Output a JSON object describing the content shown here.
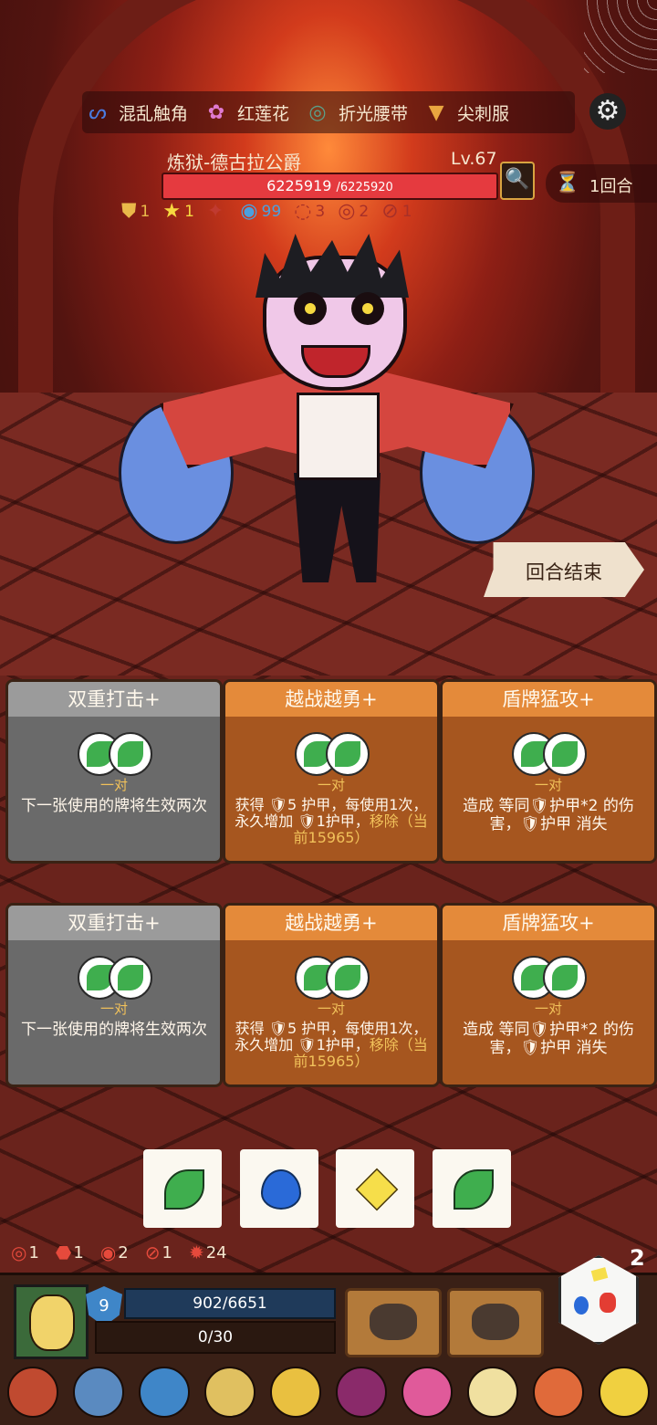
{
  "relics": [
    {
      "name": "混乱触角",
      "icon": "tentacle-icon",
      "color": "#4a7be0"
    },
    {
      "name": "红莲花",
      "icon": "lotus-icon",
      "color": "#e07ad0"
    },
    {
      "name": "折光腰带",
      "icon": "belt-icon",
      "color": "#5aa08a"
    },
    {
      "name": "尖刺服",
      "icon": "spike-armor-icon",
      "color": "#e9a640"
    }
  ],
  "boss": {
    "name": "炼狱-德古拉公爵",
    "level": "Lv.67",
    "hp_current": "6225919",
    "hp_max": "/6225920",
    "hp_fraction": 0.9999998
  },
  "round_label": "1回合",
  "boss_stats": [
    {
      "icon": "shield-stat-icon",
      "value": "1",
      "color": "#e9b94a"
    },
    {
      "icon": "star-stat-icon",
      "value": "1",
      "color": "#f6d840"
    },
    {
      "icon": "claw-stat-icon",
      "value": "",
      "color": "#e64a3c"
    },
    {
      "icon": "swirl-stat-icon",
      "value": "99",
      "color": "#4aa0e0"
    },
    {
      "icon": "hook-stat-icon",
      "value": "3",
      "color": "#c03a30"
    },
    {
      "icon": "spiral-stat-icon",
      "value": "2",
      "color": "#c03a30"
    },
    {
      "icon": "curse-stat-icon",
      "value": "1",
      "color": "#c03a30"
    }
  ],
  "end_turn_label": "回合结束",
  "cards": [
    {
      "title": "双重打击+",
      "tag": "一对",
      "desc_a": "下一张使用的牌将生效两次",
      "desc_b": "",
      "style": "gray"
    },
    {
      "title": "越战越勇+",
      "tag": "一对",
      "desc_a": "获得 🛡5 护甲，每使用1次，永久增加 🛡1护甲，",
      "desc_b": "移除（当前15965）",
      "style": "orange"
    },
    {
      "title": "盾牌猛攻+",
      "tag": "一对",
      "desc_a": "造成 等同🛡护甲*2 的伤害，🛡护甲 消失",
      "desc_b": "",
      "style": "orange"
    },
    {
      "title": "双重打击+",
      "tag": "一对",
      "desc_a": "下一张使用的牌将生效两次",
      "desc_b": "",
      "style": "gray"
    },
    {
      "title": "越战越勇+",
      "tag": "一对",
      "desc_a": "获得 🛡5 护甲，每使用1次，永久增加 🛡1护甲，",
      "desc_b": "移除（当前15965）",
      "style": "orange"
    },
    {
      "title": "盾牌猛攻+",
      "tag": "一对",
      "desc_a": "造成 等同🛡护甲*2 的伤害，🛡护甲 消失",
      "desc_b": "",
      "style": "orange"
    }
  ],
  "dice_slots": [
    "leaf-icon",
    "drop-icon",
    "diamond-icon",
    "leaf-icon"
  ],
  "player_stats": [
    {
      "icon": "target-icon",
      "value": "1"
    },
    {
      "icon": "strength-icon",
      "value": "1"
    },
    {
      "icon": "spiral-icon",
      "value": "2"
    },
    {
      "icon": "no-attack-icon",
      "value": "1"
    },
    {
      "icon": "sun-icon",
      "value": "24"
    }
  ],
  "player": {
    "armor": "9",
    "hp": "902/6651",
    "exp": "0/30"
  },
  "dice_count": "2",
  "skills": [
    "fist-skill-icon",
    "claw-skill-icon"
  ],
  "items": [
    {
      "icon": "mask-item-icon",
      "color": "#c04a30"
    },
    {
      "icon": "chestplate-item-icon",
      "color": "#5a8ac0"
    },
    {
      "icon": "shield-item-icon",
      "color": "#3f86c8"
    },
    {
      "icon": "mirror-item-icon",
      "color": "#e0c060"
    },
    {
      "icon": "die-item-icon",
      "color": "#e9c040"
    },
    {
      "icon": "robe-item-icon",
      "color": "#8a2a6a"
    },
    {
      "icon": "mushroom-item-icon",
      "color": "#e05a9a"
    },
    {
      "icon": "fang-item-icon",
      "color": "#f0e0a0"
    },
    {
      "icon": "spiky-ball-item-icon",
      "color": "#e06a3a"
    },
    {
      "icon": "cheese-item-icon",
      "color": "#f0d040"
    }
  ]
}
